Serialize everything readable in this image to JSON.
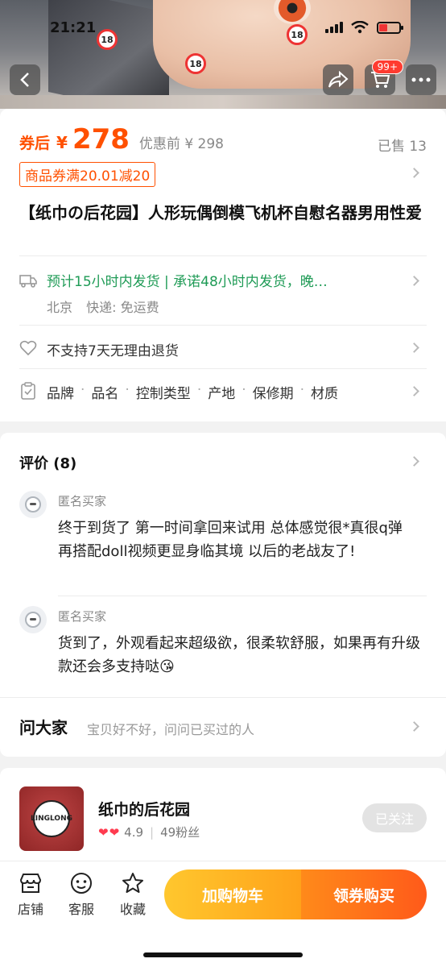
{
  "status_bar": {
    "time": "21:21"
  },
  "hero": {
    "cart_badge": "99+",
    "age_badge": "18"
  },
  "price": {
    "after_coupon_label": "券后",
    "currency": "¥",
    "value": "278",
    "original": "优惠前 ¥ 298",
    "sold": "已售 13",
    "coupon": "商品券满20.01减20"
  },
  "product_title": "【纸巾の后花园】人形玩偶倒模飞机杯自慰名器男用性爱",
  "shipping": {
    "text": "预计15小时内发货 | 承诺48小时内发货，晚…",
    "origin": "北京",
    "express": "快递: 免运费"
  },
  "returns": "不支持7天无理由退货",
  "params": [
    "品牌",
    "品名",
    "控制类型",
    "产地",
    "保修期",
    "材质"
  ],
  "param_sep": "·",
  "reviews": {
    "title": "评价 (8)",
    "items": [
      {
        "user": "匿名买家",
        "text": "终于到货了 第一时间拿回来试用 总体感觉很*真很q弹 再搭配doll视频更显身临其境 以后的老战友了!"
      },
      {
        "user": "匿名买家",
        "text": "货到了，外观看起来超级欲，很柔软舒服，如果再有升级款还会多支持哒😘"
      }
    ]
  },
  "ask": {
    "title": "问大家",
    "hint": "宝贝好不好，问问已买过的人"
  },
  "shop": {
    "name": "纸巾的后花园",
    "rating": "4.9",
    "fans": "49粉丝",
    "follow": "已关注",
    "logo_text": "LINGLONG"
  },
  "bottom_bar": {
    "store": "店铺",
    "service": "客服",
    "favorite": "收藏",
    "add_cart": "加购物车",
    "buy": "领券购买"
  },
  "colors": {
    "accent": "#ff5000",
    "ship_green": "#1f9b56",
    "cta_yellow": "#ffa21a",
    "cta_orange": "#ff5a1a"
  }
}
